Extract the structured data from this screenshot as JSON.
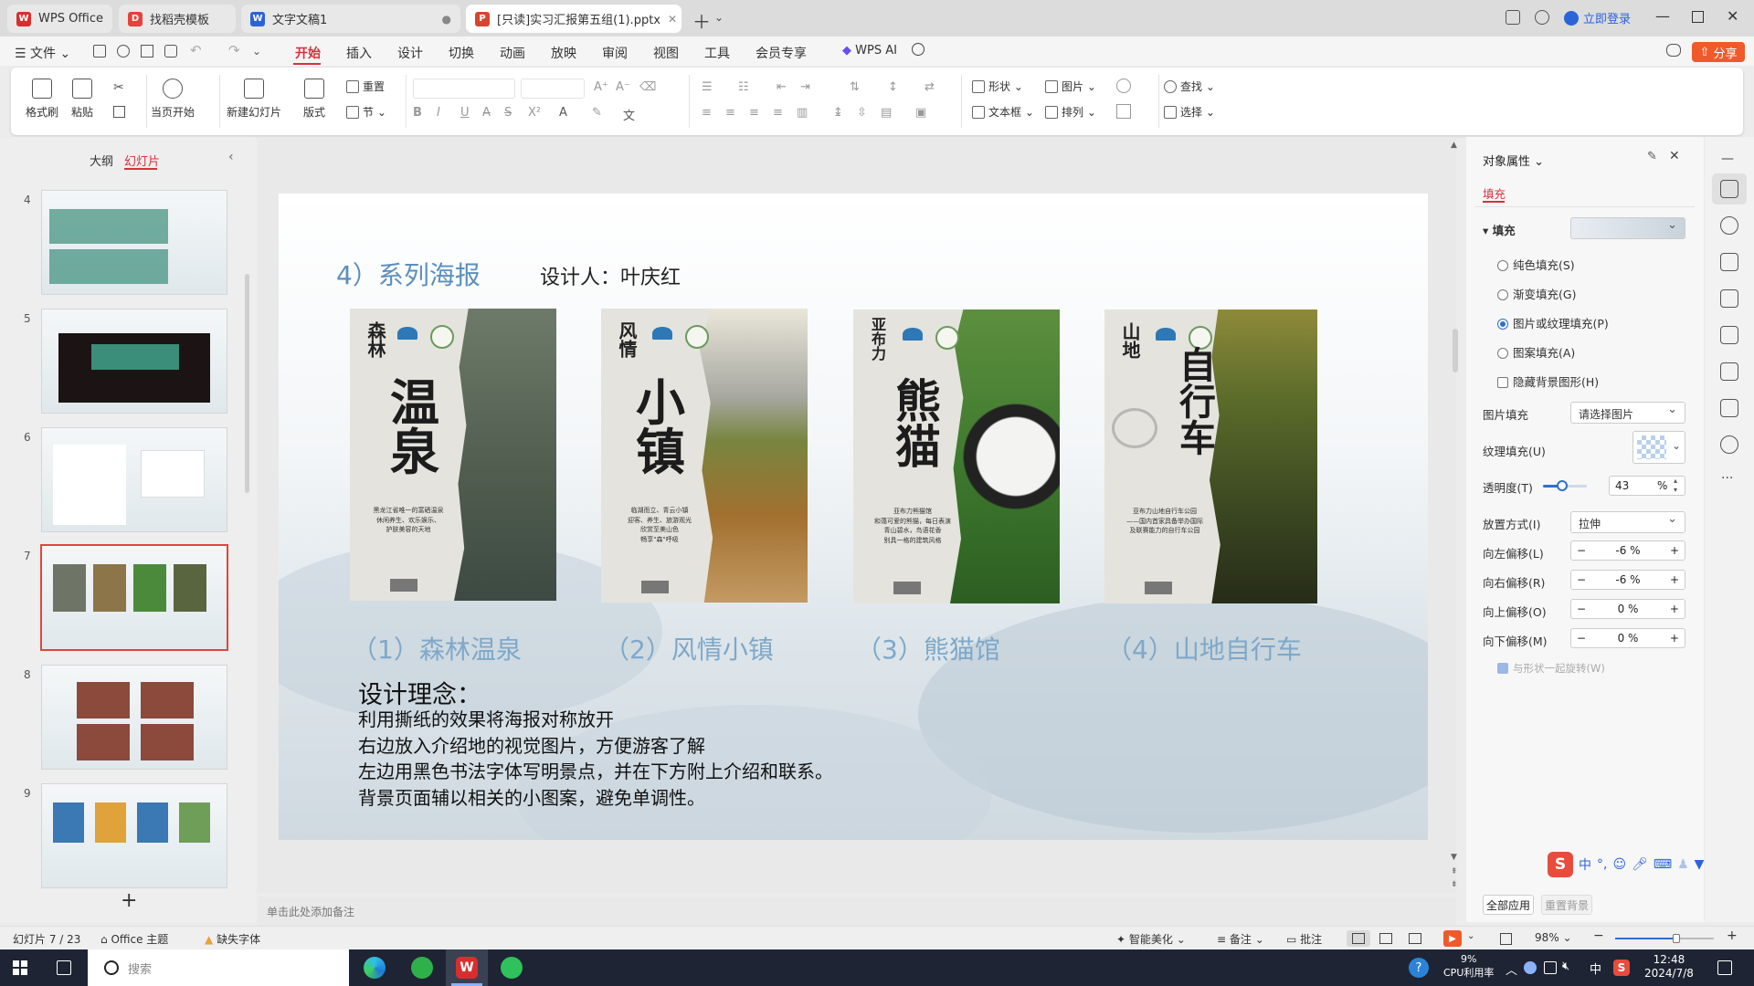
{
  "tabs": [
    {
      "label": "WPS Office",
      "color": "#d92e2e"
    },
    {
      "label": "找稻壳模板",
      "color": "#e8403a"
    },
    {
      "label": "文字文稿1",
      "color": "#2b63d8"
    },
    {
      "label": "[只读]实习汇报第五组(1).pptx",
      "color": "#d8452f"
    }
  ],
  "window_controls": {
    "login": "立即登录",
    "share": "分享"
  },
  "menu": {
    "file": "文件",
    "items": [
      "开始",
      "插入",
      "设计",
      "切换",
      "动画",
      "放映",
      "审阅",
      "视图",
      "工具",
      "会员专享"
    ],
    "wps_ai": "WPS AI"
  },
  "ribbon": {
    "format_painter": "格式刷",
    "paste": "粘贴",
    "from_current": "当页开始",
    "new_slide": "新建幻灯片",
    "layout": "版式",
    "reset": "重置",
    "section": "节",
    "shape": "形状",
    "picture": "图片",
    "textbox": "文本框",
    "arrange": "排列",
    "find": "查找",
    "select": "选择"
  },
  "left_panel": {
    "tab_outline": "大纲",
    "tab_slides": "幻灯片",
    "slide_numbers": [
      "4",
      "5",
      "6",
      "7",
      "8",
      "9"
    ],
    "add": "+"
  },
  "slide": {
    "heading": "4）系列海报",
    "designer": "设计人：叶庆红",
    "posters": [
      {
        "small": "森林",
        "big": "温泉",
        "caption": "（1）森林温泉",
        "desc": "黑龙江省唯一的富硒温泉\n休闲养生、欢乐娱乐、\n护肤美容的天地",
        "photo_color": "#5d6a5a"
      },
      {
        "small": "风情",
        "big": "小镇",
        "caption": "（2）风情小镇",
        "desc": "临湖而立、青云小镇\n迎客、养生、旅游观光\n欣赏至美山色\n畅享\"森\"呼吸",
        "photo_color": "#8a6b3d"
      },
      {
        "small": "亚布力",
        "big": "熊猫",
        "caption": "（3）熊猫馆",
        "desc": "亚布力熊猫馆\n和蔼可爱的熊猫，每日表演\n青山碧水，鸟语花香\n别具一格的建筑风格",
        "photo_color": "#3f7a2f"
      },
      {
        "small": "山地",
        "big": "自行车",
        "caption": "（4）山地自行车",
        "desc": "亚布力山地自行车公园\n——国内首家具备举办国际\n及联赛能力的自行车公园",
        "photo_color": "#4a5a30"
      }
    ],
    "concept_title": "设计理念：",
    "concept_lines": [
      "利用撕纸的效果将海报对称放开",
      "右边放入介绍地的视觉图片，方便游客了解",
      "左边用黑色书法字体写明景点，并在下方附上介绍和联系。",
      "背景页面辅以相关的小图案，避免单调性。"
    ]
  },
  "notes_placeholder": "单击此处添加备注",
  "right_panel": {
    "title": "对象属性",
    "tab_fill": "填充",
    "section_fill": "填充",
    "options": [
      "纯色填充(S)",
      "渐变填充(G)",
      "图片或纹理填充(P)",
      "图案填充(A)"
    ],
    "hide_bg": "隐藏背景图形(H)",
    "picture_fill_label": "图片填充",
    "picture_fill_value": "请选择图片",
    "texture_fill_label": "纹理填充(U)",
    "transparency_label": "透明度(T)",
    "transparency_value": "43",
    "transparency_unit": "%",
    "transparency_fraction": 0.43,
    "placement_label": "放置方式(I)",
    "placement_value": "拉伸",
    "offsets": [
      {
        "label": "向左偏移(L)",
        "value": "-6 %"
      },
      {
        "label": "向右偏移(R)",
        "value": "-6 %"
      },
      {
        "label": "向上偏移(O)",
        "value": "0 %"
      },
      {
        "label": "向下偏移(M)",
        "value": "0 %"
      }
    ],
    "rotate_with_shape": "与形状一起旋转(W)",
    "apply_all": "全部应用",
    "reset_bg": "重置背景"
  },
  "status": {
    "slide_index": "幻灯片 7 / 23",
    "theme": "Office 主题",
    "missing_font": "缺失字体",
    "beautify": "智能美化",
    "notes": "备注",
    "comments": "批注",
    "zoom": "98%",
    "zoom_fraction": 0.62
  },
  "taskbar": {
    "search": "搜索",
    "cpu_percent": "9%",
    "cpu_label": "CPU利用率",
    "time": "12:48",
    "date": "2024/7/8",
    "ime": "中"
  }
}
